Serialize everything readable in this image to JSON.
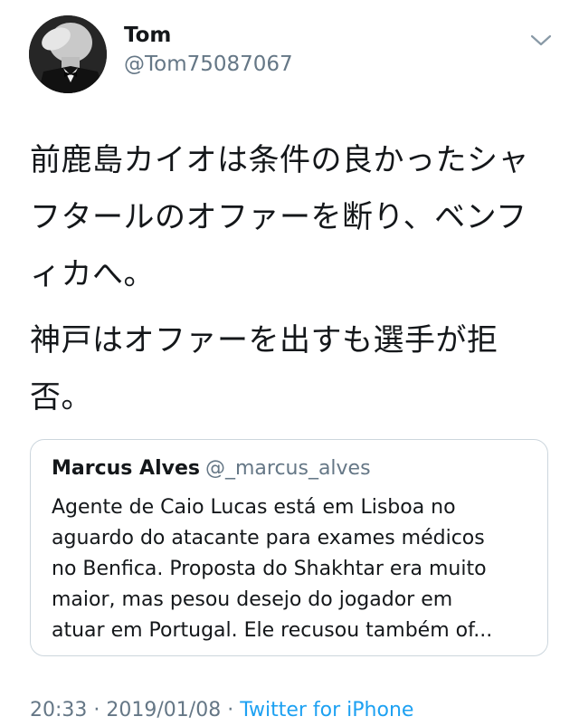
{
  "author": {
    "display_name": "Tom",
    "handle": "@Tom75087067"
  },
  "menu_icon": "chevron-down-icon",
  "tweet": {
    "paragraphs": [
      "前鹿島カイオは条件の良かったシャフタールのオファーを断り、ベンフィカへ。",
      "神戸はオファーを出すも選手が拒否。"
    ]
  },
  "quoted_tweet": {
    "display_name": "Marcus Alves",
    "handle": "@_marcus_alves",
    "lines": [
      "Agente de Caio Lucas está em Lisboa no",
      "aguardo do atacante para exames médicos",
      "no Benfica. Proposta do Shakhtar era muito",
      "maior, mas pesou desejo do jogador em",
      "atuar em Portugal. Ele recusou também of..."
    ]
  },
  "meta": {
    "time": "20:33",
    "separator": " · ",
    "date": "2019/01/08",
    "source": "Twitter for iPhone"
  },
  "colors": {
    "text": "#14171a",
    "secondary": "#657786",
    "link": "#1da1f2",
    "border": "#ccd6dd"
  }
}
